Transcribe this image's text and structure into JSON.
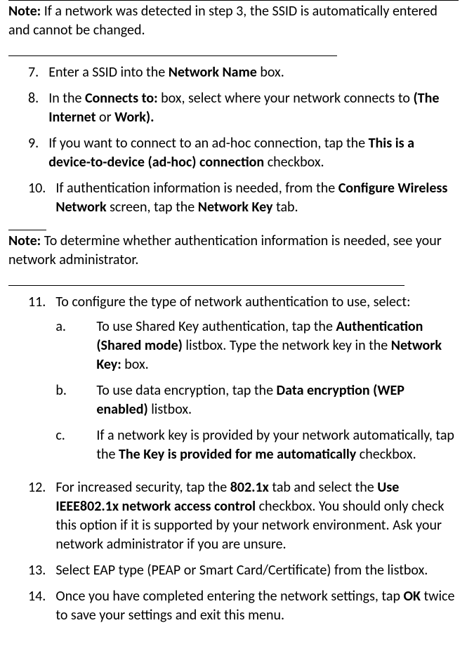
{
  "note1": {
    "label": "Note:",
    "text": " If a network was detected in step 3, the SSID is automatically entered and cannot be changed."
  },
  "steps_a": [
    {
      "num": "7.",
      "runs": [
        {
          "t": "Enter a SSID into the "
        },
        {
          "t": "Network Name",
          "b": true
        },
        {
          "t": " box."
        }
      ]
    },
    {
      "num": "8.",
      "runs": [
        {
          "t": "In the "
        },
        {
          "t": "Connects to:",
          "b": true
        },
        {
          "t": " box, select where your network connects to "
        },
        {
          "t": "(The Internet",
          "b": true
        },
        {
          "t": " or "
        },
        {
          "t": "Work).",
          "b": true
        }
      ]
    },
    {
      "num": "9.",
      "runs": [
        {
          "t": "If you want to connect to an ad-hoc connection, tap the "
        },
        {
          "t": "This is a device-to-device (ad-hoc) connection",
          "b": true
        },
        {
          "t": " checkbox."
        }
      ]
    },
    {
      "num": "10.",
      "runs": [
        {
          "t": "If authentication information is needed, from the "
        },
        {
          "t": "Configure Wireless Network",
          "b": true
        },
        {
          "t": " screen, tap the "
        },
        {
          "t": "Network Key",
          "b": true
        },
        {
          "t": " tab."
        }
      ]
    }
  ],
  "note2": {
    "label": "Note:",
    "text": " To determine whether authentication information is needed, see your network administrator."
  },
  "steps_b": [
    {
      "num": "11.",
      "runs": [
        {
          "t": "To configure the type of network authentication to use, select:"
        }
      ],
      "sub": [
        {
          "letter": "a.",
          "runs": [
            {
              "t": "To use Shared Key authentication, tap the "
            },
            {
              "t": "Authentication (Shared mode)",
              "b": true
            },
            {
              "t": " listbox. Type the network key in the "
            },
            {
              "t": "Network Key:",
              "b": true
            },
            {
              "t": " box."
            }
          ]
        },
        {
          "letter": "b.",
          "runs": [
            {
              "t": "To use data encryption, tap the "
            },
            {
              "t": "Data encryption (WEP enabled)",
              "b": true
            },
            {
              "t": " listbox."
            }
          ]
        },
        {
          "letter": "c.",
          "runs": [
            {
              "t": "If a network key is provided by your network automatically, tap the "
            },
            {
              "t": "The Key is provided for me automatically",
              "b": true
            },
            {
              "t": " checkbox."
            }
          ]
        }
      ]
    },
    {
      "num": "12.",
      "runs": [
        {
          "t": "For increased security, tap the "
        },
        {
          "t": "802.1x",
          "b": true
        },
        {
          "t": " tab and select the "
        },
        {
          "t": "Use IEEE802.1x network access control",
          "b": true
        },
        {
          "t": " checkbox. You should only check this option if it is supported by your network environment. Ask your network administrator if you are unsure."
        }
      ]
    },
    {
      "num": "13.",
      "runs": [
        {
          "t": "Select EAP type (PEAP or Smart Card/Certificate) from the listbox."
        }
      ]
    },
    {
      "num": "14.",
      "runs": [
        {
          "t": "Once you have completed entering the network settings, tap "
        },
        {
          "t": "OK",
          "b": true
        },
        {
          "t": " twice to save your settings and exit this menu."
        }
      ]
    }
  ]
}
